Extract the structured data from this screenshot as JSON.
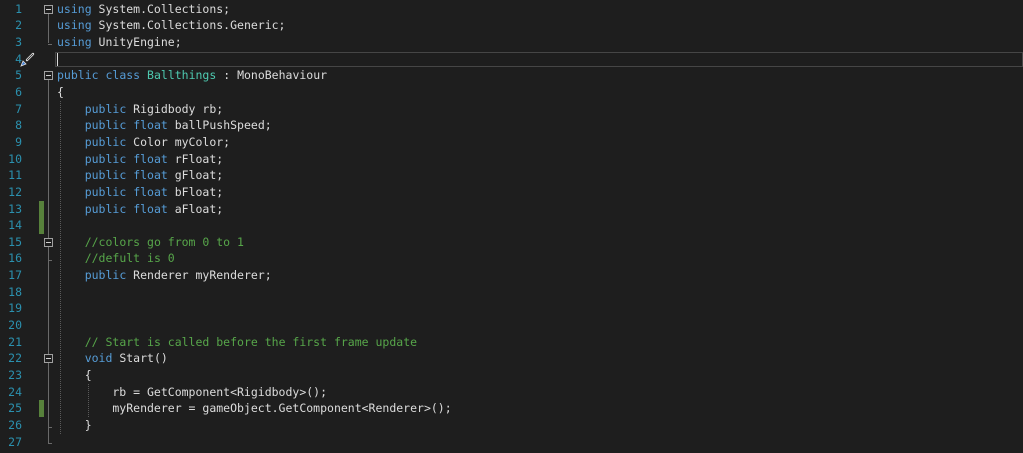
{
  "editor": {
    "current_line": 4,
    "changed_lines": [
      13,
      14,
      25
    ],
    "fold_regions": [
      [
        1,
        3
      ],
      [
        5,
        27
      ],
      [
        15,
        16
      ],
      [
        22,
        26
      ]
    ],
    "lines": [
      [
        [
          "using",
          "kw"
        ],
        [
          " System.Collections;",
          "tx"
        ]
      ],
      [
        [
          "using",
          "kw"
        ],
        [
          " System.Collections.Generic;",
          "tx"
        ]
      ],
      [
        [
          "using",
          "kw"
        ],
        [
          " UnityEngine;",
          "tx"
        ]
      ],
      [],
      [
        [
          "public",
          "kw"
        ],
        [
          " ",
          "tx"
        ],
        [
          "class",
          "kw"
        ],
        [
          " ",
          "tx"
        ],
        [
          "Ballthings",
          "ty"
        ],
        [
          " : MonoBehaviour",
          "tx"
        ]
      ],
      [
        [
          "{",
          "tx"
        ]
      ],
      [
        [
          "    ",
          "tx"
        ],
        [
          "public",
          "kw"
        ],
        [
          " Rigidbody rb;",
          "tx"
        ]
      ],
      [
        [
          "    ",
          "tx"
        ],
        [
          "public",
          "kw"
        ],
        [
          " ",
          "tx"
        ],
        [
          "float",
          "kw"
        ],
        [
          " ballPushSpeed;",
          "tx"
        ]
      ],
      [
        [
          "    ",
          "tx"
        ],
        [
          "public",
          "kw"
        ],
        [
          " Color myColor;",
          "tx"
        ]
      ],
      [
        [
          "    ",
          "tx"
        ],
        [
          "public",
          "kw"
        ],
        [
          " ",
          "tx"
        ],
        [
          "float",
          "kw"
        ],
        [
          " rFloat;",
          "tx"
        ]
      ],
      [
        [
          "    ",
          "tx"
        ],
        [
          "public",
          "kw"
        ],
        [
          " ",
          "tx"
        ],
        [
          "float",
          "kw"
        ],
        [
          " gFloat;",
          "tx"
        ]
      ],
      [
        [
          "    ",
          "tx"
        ],
        [
          "public",
          "kw"
        ],
        [
          " ",
          "tx"
        ],
        [
          "float",
          "kw"
        ],
        [
          " bFloat;",
          "tx"
        ]
      ],
      [
        [
          "    ",
          "tx"
        ],
        [
          "public",
          "kw"
        ],
        [
          " ",
          "tx"
        ],
        [
          "float",
          "kw"
        ],
        [
          " aFloat;",
          "tx"
        ]
      ],
      [],
      [
        [
          "    ",
          "tx"
        ],
        [
          "//colors go from 0 to 1",
          "cm"
        ]
      ],
      [
        [
          "    ",
          "tx"
        ],
        [
          "//defult is 0",
          "cm"
        ]
      ],
      [
        [
          "    ",
          "tx"
        ],
        [
          "public",
          "kw"
        ],
        [
          " Renderer myRenderer;",
          "tx"
        ]
      ],
      [],
      [],
      [],
      [
        [
          "    ",
          "tx"
        ],
        [
          "// Start is called before the first frame update",
          "cm"
        ]
      ],
      [
        [
          "    ",
          "tx"
        ],
        [
          "void",
          "kw"
        ],
        [
          " Start()",
          "tx"
        ]
      ],
      [
        [
          "    ",
          "tx"
        ],
        [
          "{",
          "tx"
        ]
      ],
      [
        [
          "        rb = GetComponent<Rigidbody>();",
          "tx"
        ]
      ],
      [
        [
          "        myRenderer = gameObject.GetComponent<Renderer>();",
          "tx"
        ]
      ],
      [
        [
          "    }",
          "tx"
        ]
      ],
      []
    ]
  },
  "icons": {
    "line4_gutter": "paintbrush-icon"
  }
}
